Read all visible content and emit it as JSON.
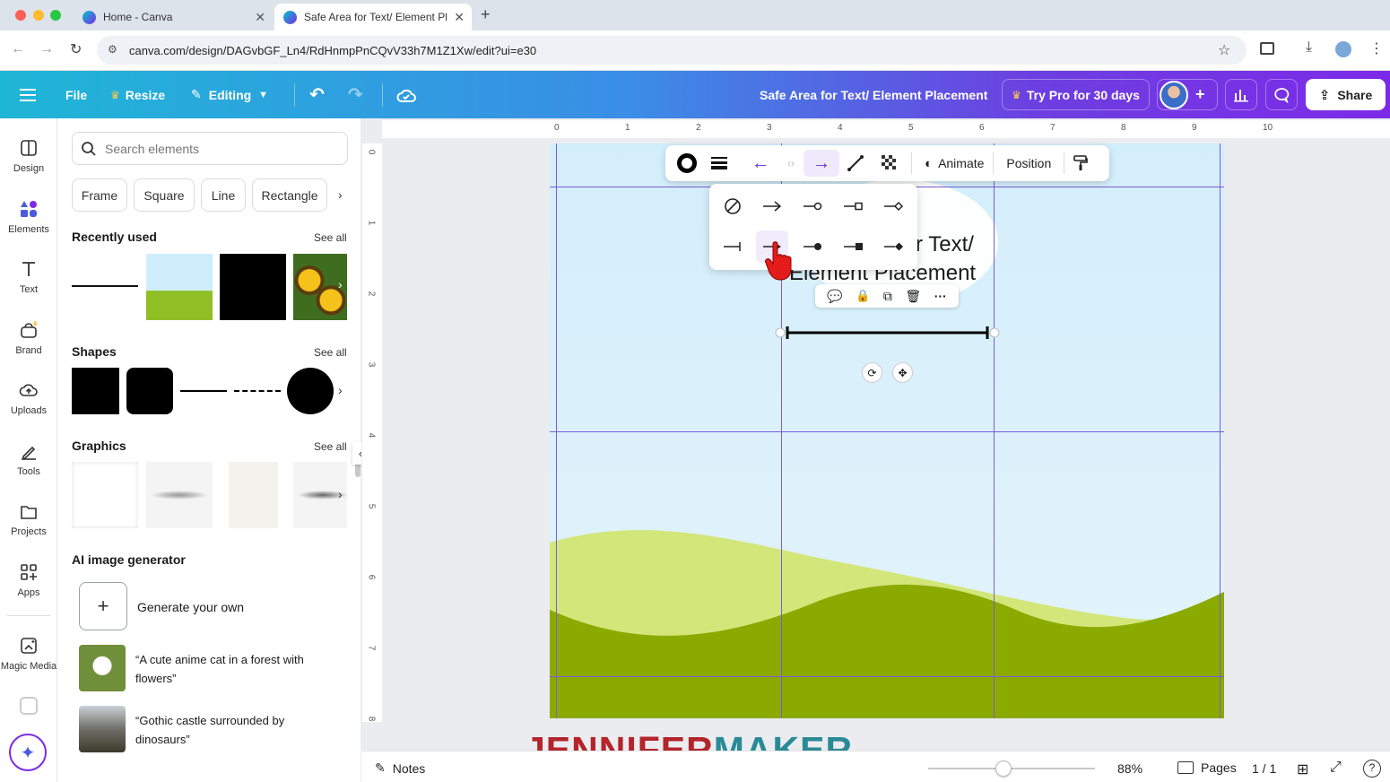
{
  "browser": {
    "tabs": [
      {
        "title": "Home - Canva"
      },
      {
        "title": "Safe Area for Text/ Element Pl"
      }
    ],
    "new_tab": "+",
    "url": "canva.com/design/DAGvbGF_Ln4/RdHnmpPnCQvV33h7M1Z1Xw/edit?ui=e30"
  },
  "header": {
    "file": "File",
    "resize": "Resize",
    "editing": "Editing",
    "design_title": "Safe Area for Text/ Element Placement",
    "try_pro": "Try Pro for 30 days",
    "share": "Share"
  },
  "rail": {
    "items": [
      {
        "label": "Design",
        "icon": "design-icon"
      },
      {
        "label": "Elements",
        "icon": "elements-icon"
      },
      {
        "label": "Text",
        "icon": "text-icon"
      },
      {
        "label": "Brand",
        "icon": "brand-icon"
      },
      {
        "label": "Uploads",
        "icon": "uploads-icon"
      },
      {
        "label": "Tools",
        "icon": "tools-icon"
      },
      {
        "label": "Projects",
        "icon": "projects-icon"
      },
      {
        "label": "Apps",
        "icon": "apps-icon"
      },
      {
        "label": "Magic Media",
        "icon": "magic-media-icon"
      }
    ],
    "active": "Elements"
  },
  "panel": {
    "search_placeholder": "Search elements",
    "chips": [
      "Frame",
      "Square",
      "Line",
      "Rectangle"
    ],
    "recently_used": "Recently used",
    "shapes": "Shapes",
    "graphics": "Graphics",
    "see_all": "See all",
    "ai_title": "AI image generator",
    "generate": "Generate your own",
    "prompts": [
      "“A cute anime cat in a forest with flowers”",
      "“Gothic castle surrounded by dinosaurs”"
    ]
  },
  "rulers": {
    "h": [
      "0",
      "1",
      "2",
      "3",
      "4",
      "5",
      "6",
      "7",
      "8",
      "9",
      "10"
    ],
    "v": [
      "0",
      "1",
      "2",
      "3",
      "4",
      "5",
      "6",
      "7",
      "8"
    ]
  },
  "canvas": {
    "text_line1": "r Text/",
    "text_line2": "Element Placement"
  },
  "context_toolbar": {
    "animate": "Animate",
    "position": "Position"
  },
  "footer": {
    "notes": "Notes",
    "zoom": "88%",
    "zoom_level": 0.45,
    "pages": "Pages",
    "page_count": "1 / 1"
  },
  "watermark": "JENNIFERMAKER",
  "colors": {
    "accent": "#7d2ae8",
    "guides": "#7b5cd6",
    "grass_light": "#d2e67a",
    "grass_dark": "#8aaa00",
    "watermark_red": "#b3242b",
    "watermark_teal": "#2a8a96"
  }
}
